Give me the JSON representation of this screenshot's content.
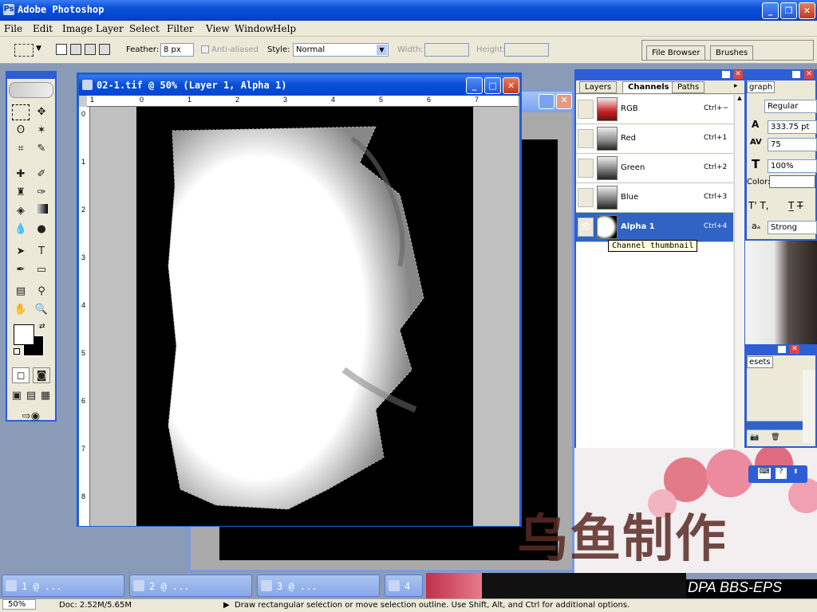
{
  "app": {
    "title": "Adobe Photoshop"
  },
  "menu": [
    "File",
    "Edit",
    "Image",
    "Layer",
    "Select",
    "Filter",
    "View",
    "Window",
    "Help"
  ],
  "options": {
    "feather_label": "Feather:",
    "feather_value": "8 px",
    "antialiased_label": "Anti-aliased",
    "style_label": "Style:",
    "style_value": "Normal",
    "width_label": "Width:",
    "height_label": "Height:",
    "palette_tabs": [
      "File Browser",
      "Brushes"
    ]
  },
  "document": {
    "title": "02-1.tif @ 50% (Layer 1, Alpha 1)",
    "ruler_h": [
      "1",
      "0",
      "1",
      "2",
      "3",
      "4",
      "5",
      "6",
      "7"
    ],
    "ruler_v": [
      "0",
      "1",
      "2",
      "3",
      "4",
      "5",
      "6",
      "7",
      "8"
    ]
  },
  "channels_panel": {
    "tabs": [
      "Layers",
      "Channels",
      "Paths"
    ],
    "rows": [
      {
        "name": "RGB",
        "shortcut": "Ctrl+~"
      },
      {
        "name": "Red",
        "shortcut": "Ctrl+1"
      },
      {
        "name": "Green",
        "shortcut": "Ctrl+2"
      },
      {
        "name": "Blue",
        "shortcut": "Ctrl+3"
      },
      {
        "name": "Alpha 1",
        "shortcut": "Ctrl+4"
      }
    ],
    "tooltip": "Channel thumbnail"
  },
  "character_panel": {
    "tab": "graph",
    "font_style": "Regular",
    "leading": "333.75 pt",
    "tracking": "75",
    "scale": "100%",
    "color_label": "Color:",
    "antialias": "Strong"
  },
  "presets_panel": {
    "tab": "esets"
  },
  "taskbar": [
    {
      "label": "1 @ ..."
    },
    {
      "label": "2 @ ..."
    },
    {
      "label": "3 @ ..."
    },
    {
      "label": "4"
    }
  ],
  "status": {
    "zoom": "50%",
    "doc": "Doc: 2.52M/5.65M",
    "hint": "Draw rectangular selection or move selection outline.  Use Shift, Alt, and Ctrl for additional options."
  },
  "watermark": "乌鱼制作",
  "banner": "DPA BBS-EPS"
}
